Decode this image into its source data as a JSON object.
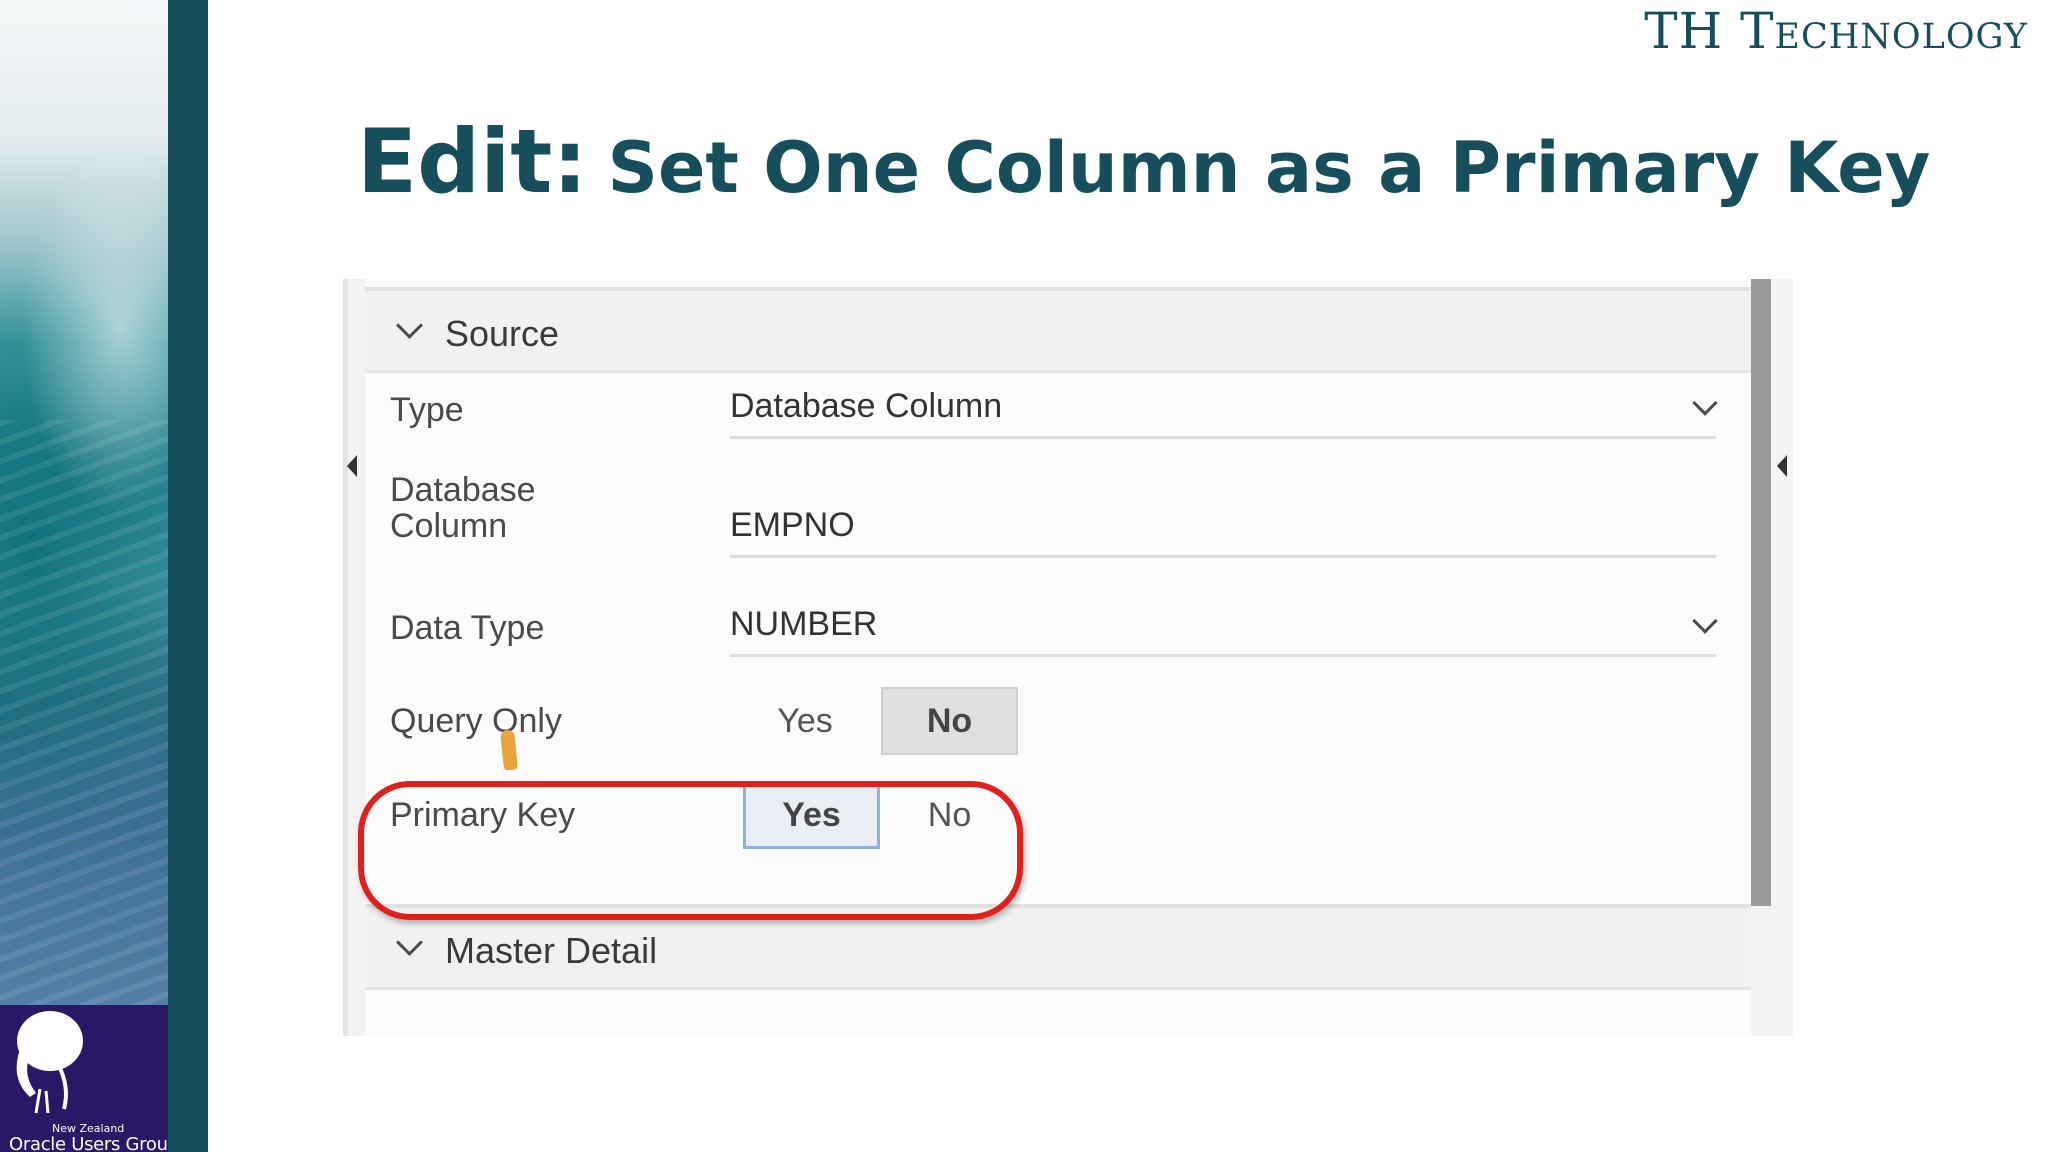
{
  "sidebar": {
    "logo_small_text": "New Zealand",
    "logo_text": "Oracle Users Group"
  },
  "header": {
    "brand": "TH Technology",
    "title_prefix": "Edit:",
    "title_rest": "Set One Column as a Primary Key"
  },
  "panel": {
    "sections": [
      {
        "title": "Source"
      },
      {
        "title": "Master Detail"
      }
    ],
    "properties": {
      "type": {
        "label": "Type",
        "value": "Database Column"
      },
      "database_column": {
        "label_line1": "Database",
        "label_line2": "Column",
        "value": "EMPNO"
      },
      "data_type": {
        "label": "Data Type",
        "value": "NUMBER"
      },
      "query_only": {
        "label": "Query Only",
        "options": [
          "Yes",
          "No"
        ],
        "selected": "No"
      },
      "primary_key": {
        "label": "Primary Key",
        "options": [
          "Yes",
          "No"
        ],
        "selected": "Yes"
      }
    }
  },
  "annotations": {
    "highlight_color": "#e0201c",
    "highlight_target": "primary_key"
  },
  "colors": {
    "title": "#174e5c",
    "teal_bar": "#174e5c",
    "logo_bg": "#2a1866",
    "selected_border": "#8ab4df"
  }
}
